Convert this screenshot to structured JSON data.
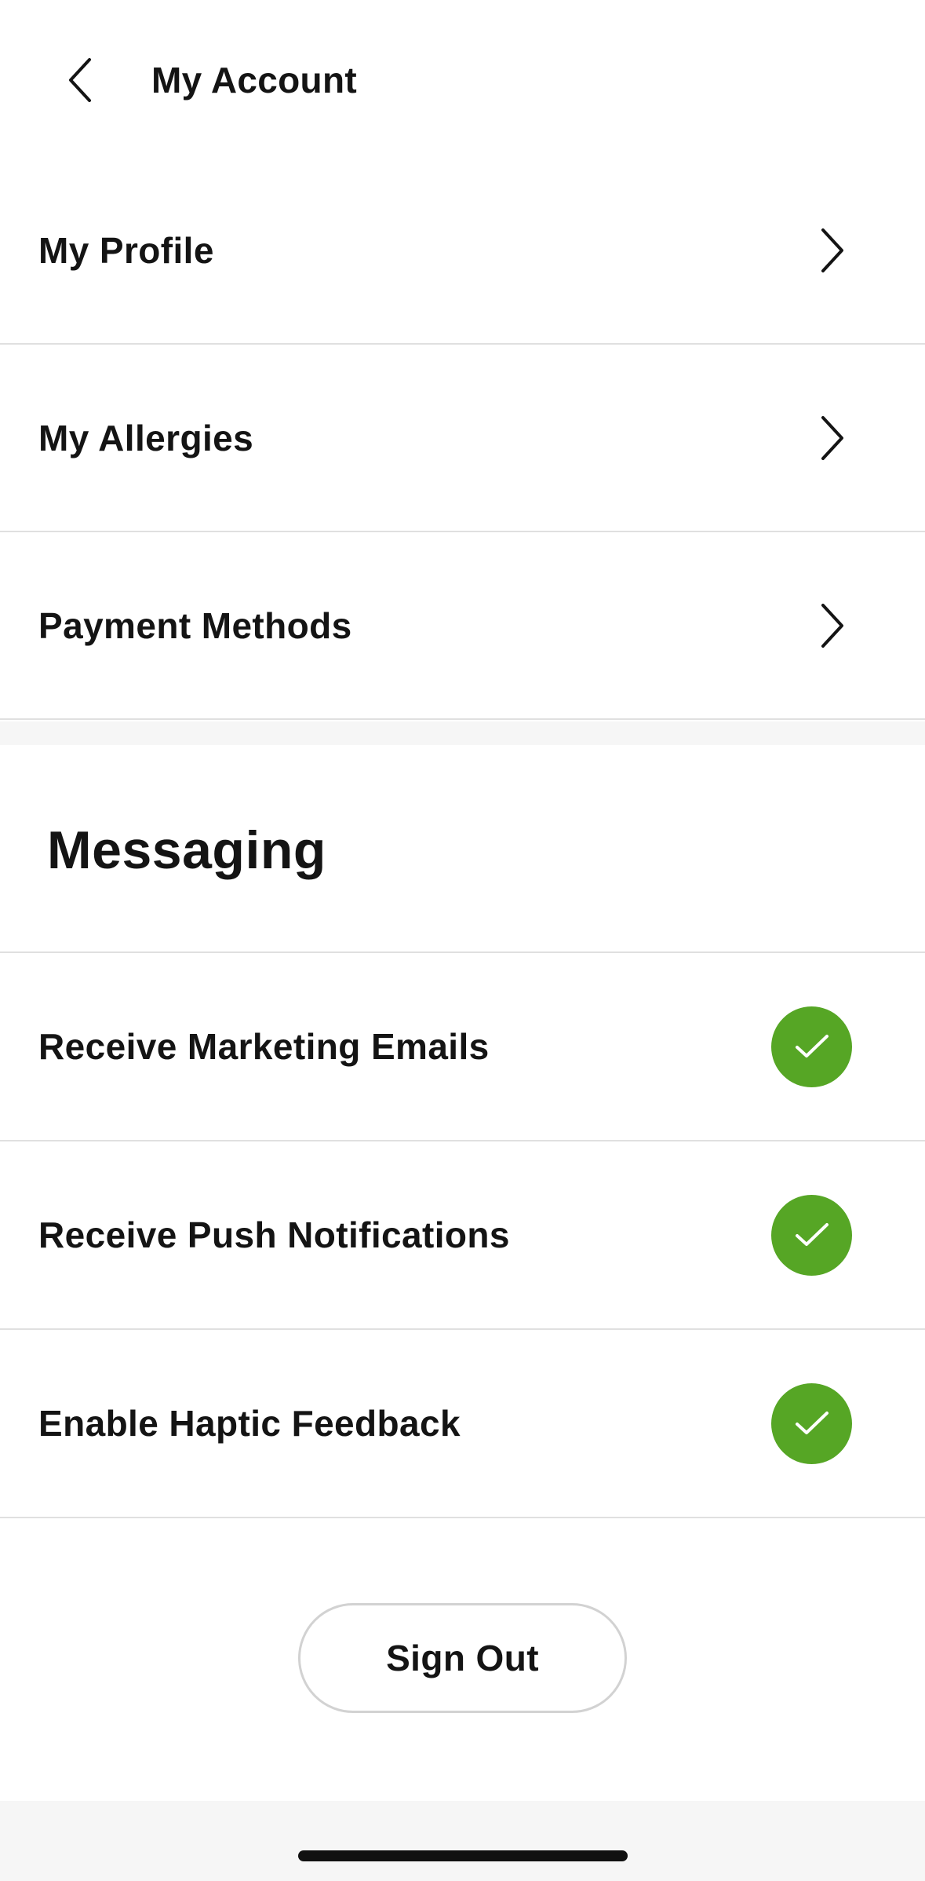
{
  "header": {
    "title": "My Account",
    "back_icon": "chevron-left-icon"
  },
  "nav_items": [
    {
      "label": "My Profile",
      "icon": "chevron-right-icon"
    },
    {
      "label": "My Allergies",
      "icon": "chevron-right-icon"
    },
    {
      "label": "Payment Methods",
      "icon": "chevron-right-icon"
    }
  ],
  "messaging": {
    "title": "Messaging",
    "toggles": [
      {
        "label": "Receive Marketing Emails",
        "checked": true,
        "icon": "checkmark-icon"
      },
      {
        "label": "Receive Push Notifications",
        "checked": true,
        "icon": "checkmark-icon"
      },
      {
        "label": "Enable Haptic Feedback",
        "checked": true,
        "icon": "checkmark-icon"
      }
    ]
  },
  "sign_out_label": "Sign Out",
  "colors": {
    "accent_green": "#56a625",
    "divider": "#e0e0e0",
    "section_background": "#f6f6f6",
    "text": "#141414"
  }
}
